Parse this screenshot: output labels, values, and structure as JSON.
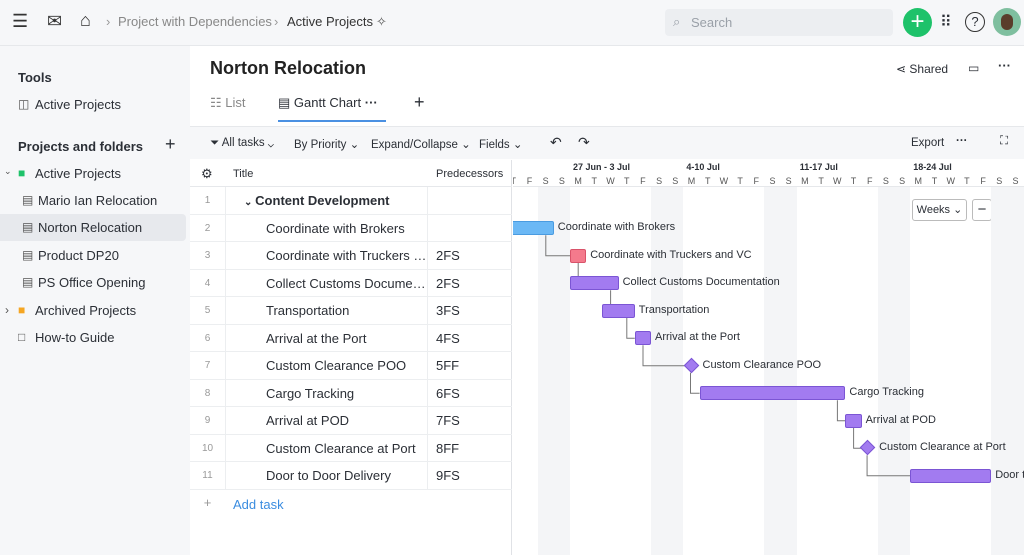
{
  "topbar": {
    "breadcrumb": [
      "Project with Dependencies",
      "Active Projects"
    ],
    "search_placeholder": "Search",
    "icons": [
      "menu-icon",
      "mail-icon",
      "home-icon",
      "pin-icon",
      "plus-icon",
      "apps-grid-icon",
      "help-icon"
    ]
  },
  "sidebar": {
    "tools_heading": "Tools",
    "tools": [
      {
        "label": "Active Projects"
      }
    ],
    "projects_heading": "Projects and folders",
    "items": [
      {
        "label": "Active Projects",
        "type": "folder",
        "color": "#1ec26a"
      },
      {
        "label": "Mario Ian Relocation",
        "type": "project"
      },
      {
        "label": "Norton Relocation",
        "type": "project",
        "selected": true
      },
      {
        "label": "Product DP20",
        "type": "project"
      },
      {
        "label": "PS Office Opening",
        "type": "project"
      },
      {
        "label": "Archived Projects",
        "type": "folder",
        "color": "#f5a623"
      },
      {
        "label": "How-to Guide",
        "type": "folder"
      }
    ]
  },
  "header": {
    "title": "Norton Relocation",
    "shared": "Shared",
    "tabs": [
      {
        "label": "List"
      },
      {
        "label": "Gantt Chart",
        "active": true
      }
    ]
  },
  "toolbar": {
    "all_tasks": "All tasks",
    "by_priority": "By Priority",
    "expand": "Expand/Collapse",
    "fields": "Fields",
    "export": "Export"
  },
  "table": {
    "col_title": "Title",
    "col_pred": "Predecessors",
    "add_task": "Add task",
    "rows": [
      {
        "n": "1",
        "title": "Content Development",
        "pred": "",
        "group": true
      },
      {
        "n": "2",
        "title": "Coordinate with Brokers",
        "pred": ""
      },
      {
        "n": "3",
        "title": "Coordinate with Truckers and VC",
        "pred": "2FS"
      },
      {
        "n": "4",
        "title": "Collect Customs Documentation",
        "pred": "2FS"
      },
      {
        "n": "5",
        "title": "Transportation",
        "pred": "3FS"
      },
      {
        "n": "6",
        "title": "Arrival at the Port",
        "pred": "4FS"
      },
      {
        "n": "7",
        "title": "Custom Clearance POO",
        "pred": "5FF"
      },
      {
        "n": "8",
        "title": "Cargo Tracking",
        "pred": "6FS"
      },
      {
        "n": "9",
        "title": "Arrival at POD",
        "pred": "7FS"
      },
      {
        "n": "10",
        "title": "Custom Clearance at Port",
        "pred": "8FF"
      },
      {
        "n": "11",
        "title": "Door to Door Delivery",
        "pred": "9FS"
      }
    ]
  },
  "gantt": {
    "scale": "Weeks",
    "weeks": [
      "27 Jun - 3 Jul",
      "4-10 Jul",
      "11-17 Jul",
      "18-24 Jul"
    ],
    "day_letters": [
      "M",
      "T",
      "W",
      "T",
      "F",
      "S",
      "S"
    ],
    "colors": {
      "blue": "#6bb8f5",
      "pink": "#f47a8c",
      "purple": "#a27bf0"
    },
    "bars": [
      {
        "row": 1,
        "label": "Coordinate with Brokers",
        "start": -4,
        "end": -2,
        "color": "blue"
      },
      {
        "row": 2,
        "label": "Coordinate with Truckers and VC",
        "start": 0,
        "end": 0,
        "color": "pink"
      },
      {
        "row": 3,
        "label": "Collect Customs Documentation",
        "start": 0,
        "end": 2,
        "color": "purple"
      },
      {
        "row": 4,
        "label": "Transportation",
        "start": 2,
        "end": 3,
        "color": "purple"
      },
      {
        "row": 5,
        "label": "Arrival at the Port",
        "start": 4,
        "end": 4,
        "color": "purple"
      },
      {
        "row": 6,
        "label": "Custom Clearance POO",
        "start": 7.5,
        "milestone": true
      },
      {
        "row": 7,
        "label": "Cargo Tracking",
        "start": 8,
        "end": 16,
        "color": "purple"
      },
      {
        "row": 8,
        "label": "Arrival at POD",
        "start": 17,
        "end": 17,
        "color": "purple"
      },
      {
        "row": 9,
        "label": "Custom Clearance at Port",
        "start": 18.4,
        "milestone": true
      },
      {
        "row": 10,
        "label": "Door to Door Delivery",
        "start": 21,
        "end": 25,
        "color": "purple"
      }
    ]
  }
}
